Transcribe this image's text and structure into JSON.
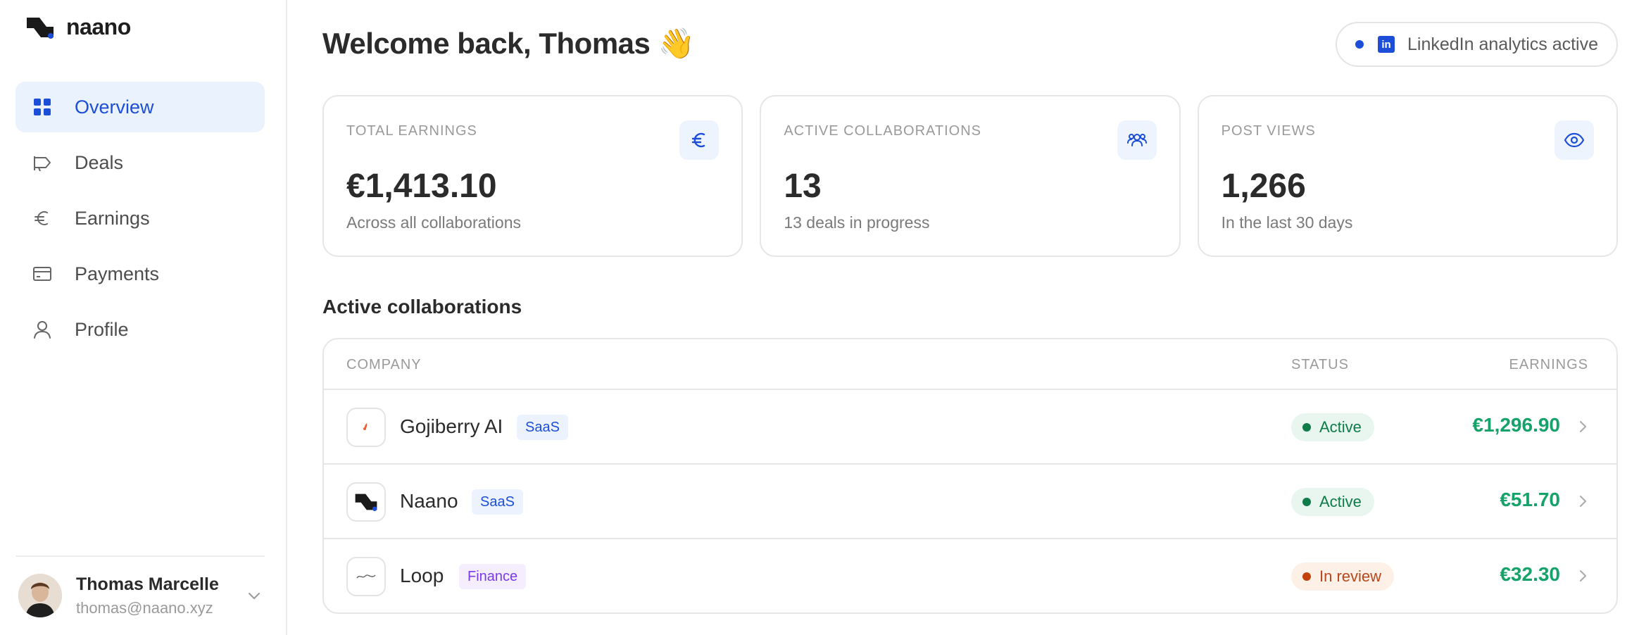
{
  "brand": {
    "name": "naano"
  },
  "sidebar": {
    "items": [
      {
        "label": "Overview",
        "icon": "grid-icon",
        "active": true
      },
      {
        "label": "Deals",
        "icon": "megaphone-icon",
        "active": false
      },
      {
        "label": "Earnings",
        "icon": "euro-icon",
        "active": false
      },
      {
        "label": "Payments",
        "icon": "credit-card-icon",
        "active": false
      },
      {
        "label": "Profile",
        "icon": "user-icon",
        "active": false
      }
    ]
  },
  "user": {
    "name": "Thomas Marcelle",
    "email": "thomas@naano.xyz"
  },
  "header": {
    "welcome": "Welcome back, Thomas 👋",
    "linkedin_badge": "in",
    "linkedin_status": "LinkedIn analytics active"
  },
  "stats": [
    {
      "title": "TOTAL EARNINGS",
      "value": "€1,413.10",
      "sub": "Across all collaborations",
      "icon": "euro-icon"
    },
    {
      "title": "ACTIVE COLLABORATIONS",
      "value": "13",
      "sub": "13 deals in progress",
      "icon": "users-icon"
    },
    {
      "title": "POST VIEWS",
      "value": "1,266",
      "sub": "In the last 30 days",
      "icon": "eye-icon"
    }
  ],
  "collaborations": {
    "title": "Active collaborations",
    "columns": {
      "company": "COMPANY",
      "status": "STATUS",
      "earnings": "EARNINGS"
    },
    "rows": [
      {
        "company": "Gojiberry AI",
        "tag": "SaaS",
        "status": "Active",
        "earnings": "€1,296.90"
      },
      {
        "company": "Naano",
        "tag": "SaaS",
        "status": "Active",
        "earnings": "€51.70"
      },
      {
        "company": "Loop",
        "tag": "Finance",
        "status": "In review",
        "earnings": "€32.30"
      }
    ]
  },
  "colors": {
    "accent": "#1d4ed8",
    "success": "#16a36a",
    "warning": "#c2410c"
  }
}
